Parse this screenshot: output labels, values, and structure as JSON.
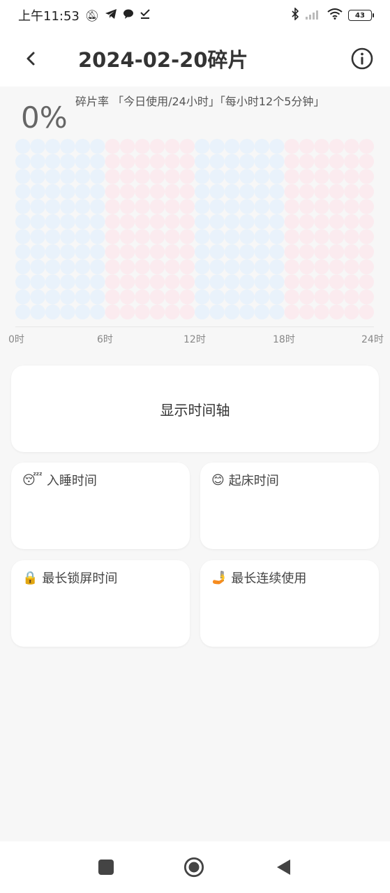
{
  "status_bar": {
    "time": "上午11:53",
    "battery": "43"
  },
  "header": {
    "title": "2024-02-20碎片"
  },
  "summary": {
    "label": "碎片率 「今日使用/24小时」「每小时12个5分钟」",
    "percent": "0%"
  },
  "chart_data": {
    "type": "heatmap",
    "rows": 12,
    "hours": 24,
    "x_ticks": [
      "0时",
      "6时",
      "12时",
      "18时",
      "24时"
    ],
    "colors": {
      "block_a": "#e9f2fb",
      "block_b": "#fbebef"
    },
    "used_slots": 0
  },
  "timeline_button": {
    "label": "显示时间轴"
  },
  "stats": [
    {
      "emoji": "😴",
      "label": "入睡时间"
    },
    {
      "emoji": "😊",
      "label": "起床时间"
    },
    {
      "emoji": "🔒",
      "label": "最长锁屏时间"
    },
    {
      "emoji": "🤳",
      "label": "最长连续使用"
    }
  ],
  "icons": {
    "back": "chevron-left-icon",
    "info": "info-icon",
    "nav_recent": "square-icon",
    "nav_home": "circle-icon",
    "nav_back": "triangle-back-icon"
  }
}
